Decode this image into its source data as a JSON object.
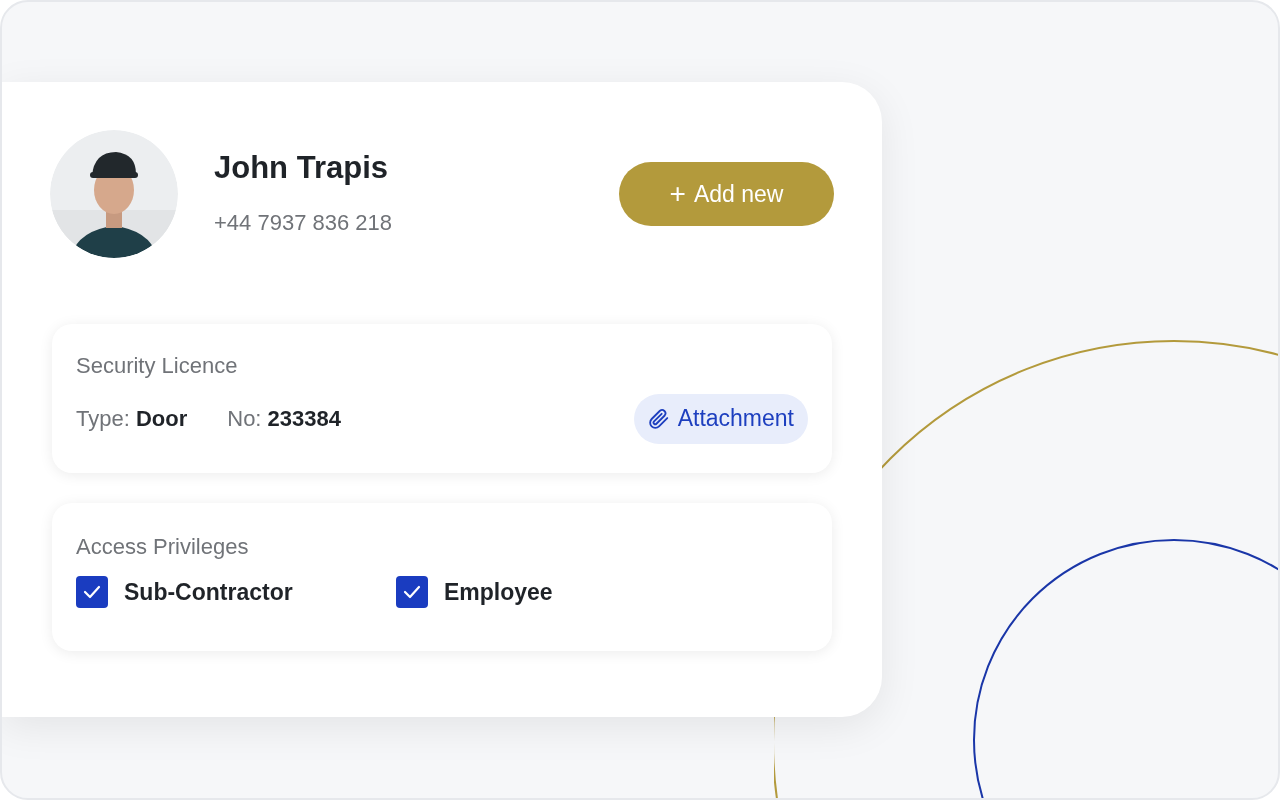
{
  "profile": {
    "name": "John Trapis",
    "phone": "+44 7937 836 218"
  },
  "add_button": {
    "icon": "+",
    "label": "Add new"
  },
  "licence": {
    "title": "Security Licence",
    "fields": [
      "Type: **Door**",
      "No: **233384**"
    ],
    "attachment": "Attachment"
  },
  "privileges": {
    "title": "Access Privileges",
    "items": [
      {
        "label": "Sub-Contractor",
        "checked": true
      },
      {
        "label": "Employee",
        "checked": true
      }
    ]
  }
}
